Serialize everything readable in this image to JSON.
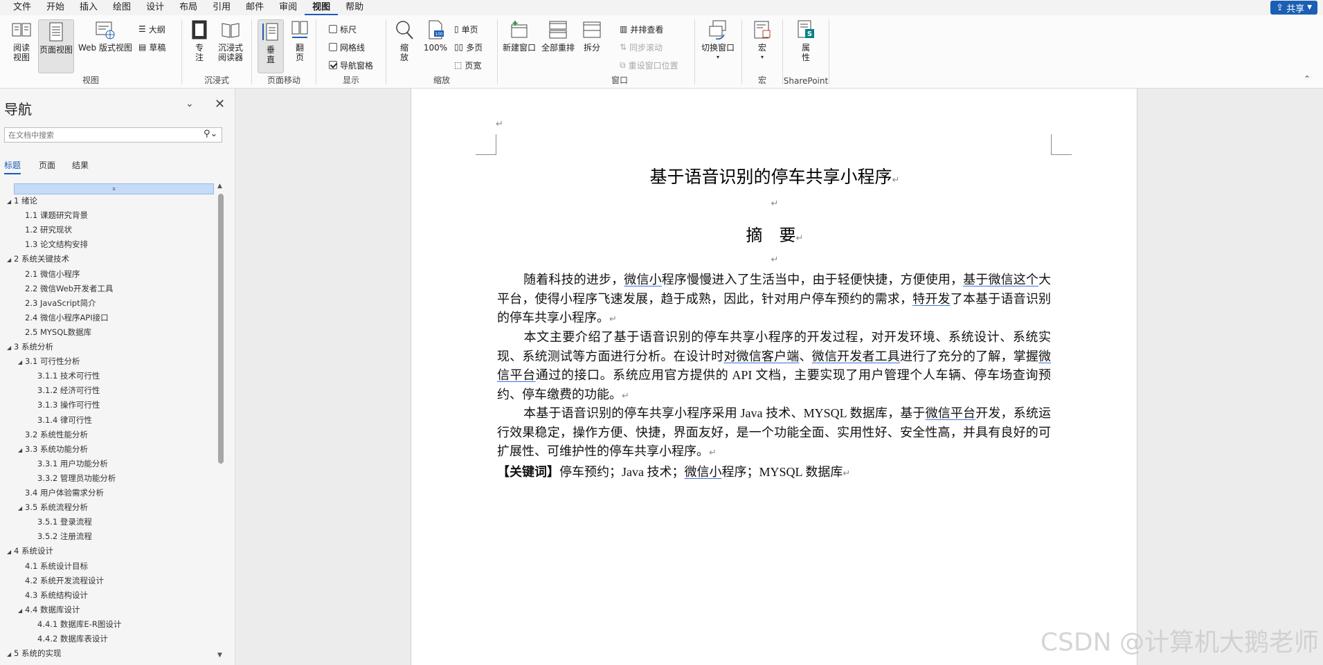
{
  "menu": [
    "文件",
    "开始",
    "插入",
    "绘图",
    "设计",
    "布局",
    "引用",
    "邮件",
    "审阅",
    "视图",
    "帮助"
  ],
  "menu_active": "视图",
  "share_label": "共享",
  "ribbon": {
    "view": {
      "read_mode": "阅读视图",
      "print_layout": "页面视图",
      "web_layout": "Web 版式视图",
      "outline": "大纲",
      "draft": "草稿",
      "label": "视图"
    },
    "immersive": {
      "focus": "专注",
      "immersive_reader": "沉浸式阅读器",
      "label": "沉浸式"
    },
    "page_move": {
      "vertical": "垂直",
      "side_to_side": "翻页",
      "label": "页面移动"
    },
    "show": {
      "ruler": "标尺",
      "gridlines": "网格线",
      "nav_pane": "导航窗格",
      "label": "显示",
      "ruler_on": false,
      "gridlines_on": false,
      "nav_pane_on": true
    },
    "zoom": {
      "zoom": "缩放",
      "zoom_100": "100%",
      "one_page": "单页",
      "multiple_pages": "多页",
      "page_width": "页宽",
      "label": "缩放"
    },
    "window": {
      "new_window": "新建窗口",
      "arrange_all": "全部重排",
      "split": "拆分",
      "side_by_side": "并排查看",
      "sync_scroll": "同步滚动",
      "reset_position": "重设窗口位置",
      "switch_windows": "切换窗口",
      "label": "窗口"
    },
    "macros": {
      "macros": "宏",
      "label": "宏"
    },
    "sharepoint": {
      "properties": "属性",
      "label": "SharePoint"
    }
  },
  "nav": {
    "title": "导航",
    "search_placeholder": "在文档中搜索",
    "tabs": [
      "标题",
      "页面",
      "结果"
    ],
    "tree": [
      {
        "level": 1,
        "text": "1 绪论",
        "arrow": true
      },
      {
        "level": 2,
        "text": "1.1 课题研究背景",
        "arrow": false
      },
      {
        "level": 2,
        "text": "1.2 研究现状",
        "arrow": false
      },
      {
        "level": 2,
        "text": "1.3 论文结构安排",
        "arrow": false
      },
      {
        "level": 1,
        "text": "2 系统关键技术",
        "arrow": true
      },
      {
        "level": 2,
        "text": "2.1 微信小程序",
        "arrow": false
      },
      {
        "level": 2,
        "text": "2.2 微信Web开发者工具",
        "arrow": false
      },
      {
        "level": 2,
        "text": "2.3 JavaScript简介",
        "arrow": false
      },
      {
        "level": 2,
        "text": "2.4 微信小程序API接口",
        "arrow": false
      },
      {
        "level": 2,
        "text": "2.5 MYSQL数据库",
        "arrow": false
      },
      {
        "level": 1,
        "text": "3 系统分析",
        "arrow": true
      },
      {
        "level": 2,
        "text": "3.1 可行性分析",
        "arrow": true
      },
      {
        "level": 3,
        "text": "3.1.1 技术可行性",
        "arrow": false
      },
      {
        "level": 3,
        "text": "3.1.2 经济可行性",
        "arrow": false
      },
      {
        "level": 3,
        "text": "3.1.3 操作可行性",
        "arrow": false
      },
      {
        "level": 3,
        "text": "3.1.4 律可行性",
        "arrow": false
      },
      {
        "level": 2,
        "text": "3.2 系统性能分析",
        "arrow": false
      },
      {
        "level": 2,
        "text": "3.3 系统功能分析",
        "arrow": true
      },
      {
        "level": 3,
        "text": "3.3.1 用户功能分析",
        "arrow": false
      },
      {
        "level": 3,
        "text": "3.3.2 管理员功能分析",
        "arrow": false
      },
      {
        "level": 2,
        "text": "3.4 用户体验需求分析",
        "arrow": false
      },
      {
        "level": 2,
        "text": "3.5 系统流程分析",
        "arrow": true
      },
      {
        "level": 3,
        "text": "3.5.1 登录流程",
        "arrow": false
      },
      {
        "level": 3,
        "text": "3.5.2 注册流程",
        "arrow": false
      },
      {
        "level": 1,
        "text": "4 系统设计",
        "arrow": true
      },
      {
        "level": 2,
        "text": "4.1 系统设计目标",
        "arrow": false
      },
      {
        "level": 2,
        "text": "4.2 系统开发流程设计",
        "arrow": false
      },
      {
        "level": 2,
        "text": "4.3 系统结构设计",
        "arrow": false
      },
      {
        "level": 2,
        "text": "4.4 数据库设计",
        "arrow": true
      },
      {
        "level": 3,
        "text": "4.4.1 数据库E-R图设计",
        "arrow": false
      },
      {
        "level": 3,
        "text": "4.4.2 数据库表设计",
        "arrow": false
      },
      {
        "level": 1,
        "text": "5 系统的实现",
        "arrow": true
      }
    ]
  },
  "document": {
    "title": "基于语音识别的停车共享小程序",
    "abstract_heading": "摘　要",
    "p1": {
      "a": "随着科技的进步，",
      "u1": "微信小",
      "b": "程序慢慢进入了生活当中，由于轻便快捷，方便使用，",
      "u2": "基于微信这个",
      "c": "大平台，使得小程序飞速发展，趋于成熟，因此，针对用户停车预约的需求，",
      "u3": "特开发",
      "d": "了本基于语音识别的停车共享小程序。"
    },
    "p2": {
      "a": "本文主要介绍了基于语音识别的停车共享小程序的开发过程，对开发环境、系统设计、系统实现、系统测试等方面进行分析。在设计时",
      "u1": "对微信客户端",
      "b": "、",
      "u2": "微信开发者工具",
      "c": "进行了充分的了解，掌握",
      "u3": "微信平台",
      "d": "通过的接口。系统应用官方提供的 API 文档，主要实现了用户管理个人车辆、停车场查询预约、停车缴费的功能。"
    },
    "p3": {
      "a": "本基于语音识别的停车共享小程序采用 Java 技术、MYSQL 数据库，基于",
      "u1": "微信平台",
      "b": "开发，系统运行效果稳定，操作方便、快捷，界面友好，是一个功能全面、实用性好、安全性高，并具有良好的可扩展性、可维护性的停车共享小程序。"
    },
    "keywords": {
      "label": "【关键词】",
      "a": "停车预约；Java 技术；",
      "u1": "微信小",
      "b": "程序；MYSQL 数据库"
    }
  },
  "watermark": "CSDN @计算机大鹅老师",
  "colors": {
    "accent": "#185abd",
    "share_bg": "#1a5fb4",
    "underline": "#3b6ee0"
  }
}
